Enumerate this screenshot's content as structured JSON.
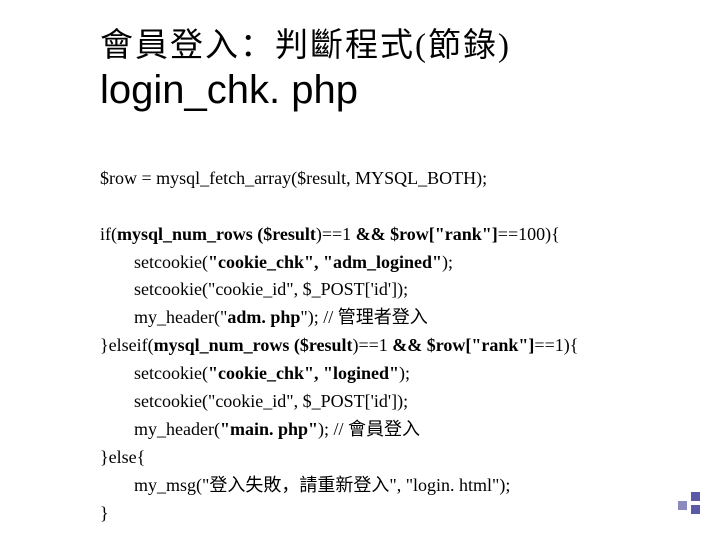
{
  "title": {
    "cn": "會員登入：判斷程式(節錄)",
    "fn": "login_chk. php"
  },
  "code": {
    "l1": "$row = mysql_fetch_array($result, MYSQL_BOTH);",
    "l2a": "if(",
    "l2b": "mysql_num_rows ($result",
    "l2c": ")==1 ",
    "l2d": "&& $row[\"rank\"]",
    "l2e": "==100){",
    "l3a": "setcookie(",
    "l3b": "\"cookie_chk\", \"adm_logined\"",
    "l3c": ");",
    "l4": "setcookie(\"cookie_id\", $_POST['id']);",
    "l5a": "my_header(\"",
    "l5b": "adm. php",
    "l5c": "\"); // 管理者登入",
    "l6a": "}elseif(",
    "l6b": "mysql_num_rows ($result",
    "l6c": ")==1 ",
    "l6d": "&& $row[\"rank\"]",
    "l6e": "==1",
    "l6f": "){",
    "l7a": "setcookie(",
    "l7b": "\"cookie_chk\", \"logined\"",
    "l7c": ");",
    "l8": "setcookie(\"cookie_id\", $_POST['id']);",
    "l9a": "my_header(",
    "l9b": "\"main. php\"",
    "l9c": "); // 會員登入",
    "l10": "}else{",
    "l11": "my_msg(\"登入失敗，請重新登入\", \"login. html\");",
    "l12": "}"
  }
}
